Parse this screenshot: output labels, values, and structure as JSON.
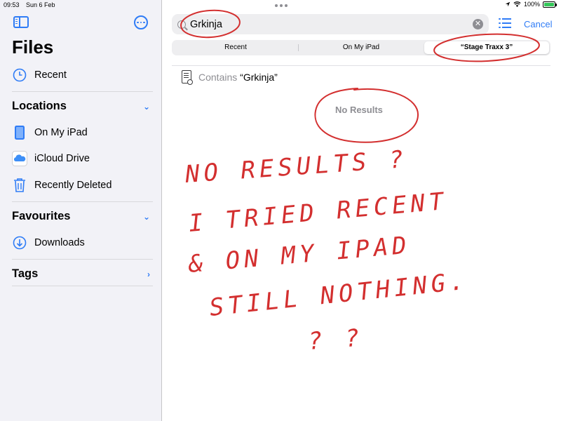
{
  "status": {
    "time": "09:53",
    "date": "Sun 6 Feb",
    "battery": "100%"
  },
  "sidebar": {
    "title": "Files",
    "recent": "Recent",
    "locations": {
      "title": "Locations",
      "items": [
        "On My iPad",
        "iCloud Drive",
        "Recently Deleted"
      ]
    },
    "favourites": {
      "title": "Favourites",
      "items": [
        "Downloads"
      ]
    },
    "tags": {
      "title": "Tags"
    }
  },
  "search": {
    "value": "Grkinja",
    "cancel": "Cancel",
    "scopes": [
      "Recent",
      "On My iPad",
      "“Stage Traxx 3”"
    ],
    "selected_scope": 2
  },
  "results": {
    "contains_prefix": "Contains ",
    "contains_query": "“Grkinja”",
    "empty": "No Results"
  },
  "annotation": {
    "lines": [
      "NO RESULTS ?",
      "I TRIED RECENT",
      "& ON MY IPAD",
      "STILL NOTHING.",
      "? ?"
    ],
    "ink_color": "#d32f2f"
  },
  "colors": {
    "accent": "#2f7cf6",
    "sidebar_bg": "#f2f2f7"
  }
}
